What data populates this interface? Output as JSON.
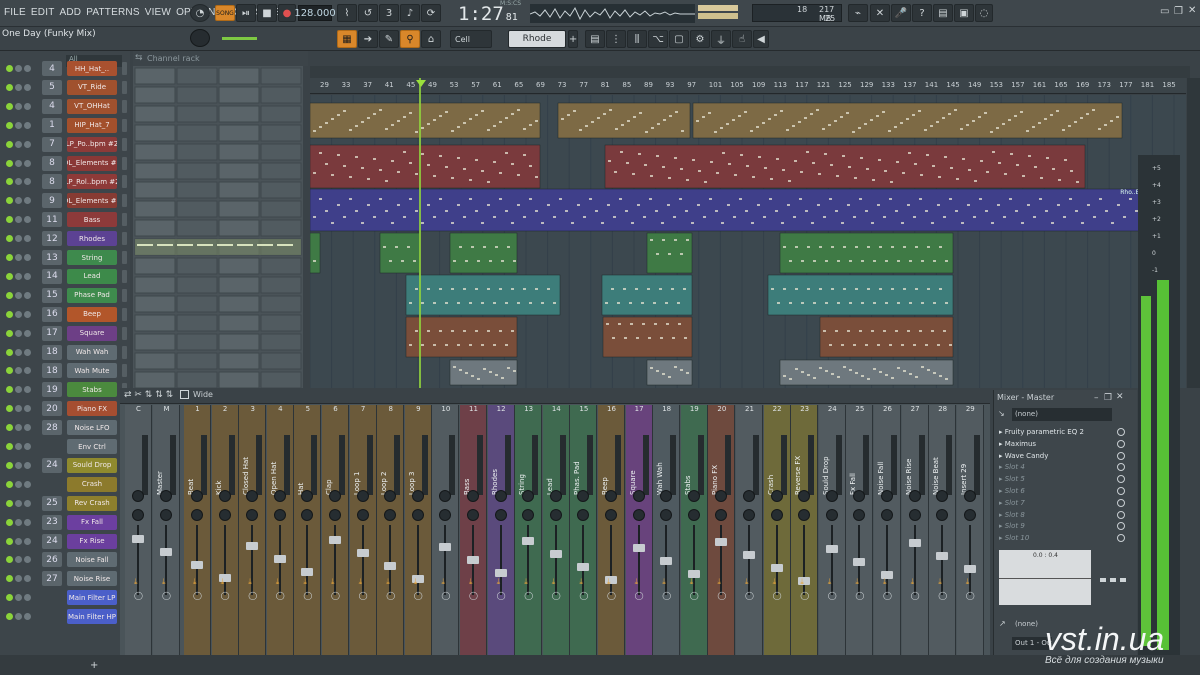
{
  "menu": [
    "FILE",
    "EDIT",
    "ADD",
    "PATTERNS",
    "VIEW",
    "OPTIONS",
    "TOOLS",
    "HELP"
  ],
  "transport": {
    "mode": "SONG",
    "tempo": "128.000",
    "position": "1:27",
    "position_ticks": "81",
    "position_unit": "M:S:CS"
  },
  "cpu": {
    "voices": "18",
    "memory": "217 MB",
    "polyphony": "25"
  },
  "song_title": "One Day (Funky Mix)",
  "hint_toolbar": {
    "snap": "Cell",
    "pattern": "Rhode"
  },
  "channel_rack": {
    "title": "Channel rack",
    "filter": "All",
    "channels": [
      {
        "num": "4",
        "name": "HH_Hat_..",
        "color": "#a9512f"
      },
      {
        "num": "5",
        "name": "VT_Ride",
        "color": "#a0512e"
      },
      {
        "num": "4",
        "name": "VT_OHHat",
        "color": "#a0512e"
      },
      {
        "num": "1",
        "name": "HIP_Hat_7",
        "color": "#a3502c"
      },
      {
        "num": "7",
        "name": "LP_Po..bpm #2",
        "color": "#8d3a38"
      },
      {
        "num": "8",
        "name": "DL_Elements #2",
        "color": "#8a3836"
      },
      {
        "num": "8",
        "name": "LP_Rol..bpm #2",
        "color": "#8e3a38"
      },
      {
        "num": "9",
        "name": "DL_Elements #3",
        "color": "#873b33"
      },
      {
        "num": "11",
        "name": "Bass",
        "color": "#8d3a3a"
      },
      {
        "num": "12",
        "name": "Rhodes",
        "color": "#5c4293"
      },
      {
        "num": "13",
        "name": "String",
        "color": "#3e8a4d"
      },
      {
        "num": "14",
        "name": "Lead",
        "color": "#3d8a4a"
      },
      {
        "num": "15",
        "name": "Phase Pad",
        "color": "#3e8b4d"
      },
      {
        "num": "16",
        "name": "Beep",
        "color": "#b2562a"
      },
      {
        "num": "17",
        "name": "Square",
        "color": "#6d3f86"
      },
      {
        "num": "18",
        "name": "Wah Wah",
        "color": "#5f6b72"
      },
      {
        "num": "18",
        "name": "Wah Mute",
        "color": "#5f6b72"
      },
      {
        "num": "19",
        "name": "Stabs",
        "color": "#4b8a3e"
      },
      {
        "num": "20",
        "name": "Piano FX",
        "color": "#a54e31"
      },
      {
        "num": "28",
        "name": "Noise LFO",
        "color": "#5f6b72"
      },
      {
        "num": "",
        "name": "Env Ctrl",
        "color": "#5f6b72"
      },
      {
        "num": "24",
        "name": "Sould Drop",
        "color": "#8f8a2e"
      },
      {
        "num": "",
        "name": "Crash",
        "color": "#8c7a2c"
      },
      {
        "num": "25",
        "name": "Rev Crash",
        "color": "#8d7f2d"
      },
      {
        "num": "23",
        "name": "Fx Fall",
        "color": "#6c3fa0"
      },
      {
        "num": "24",
        "name": "Fx Rise",
        "color": "#6b3f9e"
      },
      {
        "num": "26",
        "name": "Noise Fall",
        "color": "#5f6b72"
      },
      {
        "num": "27",
        "name": "Noise Rise",
        "color": "#5f6b72"
      },
      {
        "num": "",
        "name": "Main Filter LP",
        "color": "#4b5fc9"
      },
      {
        "num": "",
        "name": "Main Filter HP",
        "color": "#4b5fc9"
      }
    ]
  },
  "playlist": {
    "bars": [
      "29",
      "33",
      "37",
      "41",
      "45",
      "49",
      "53",
      "57",
      "61",
      "65",
      "69",
      "73",
      "77",
      "81",
      "85",
      "89",
      "93",
      "97",
      "101",
      "105",
      "109",
      "113",
      "117",
      "121",
      "125",
      "129",
      "133",
      "137",
      "141",
      "145",
      "149",
      "153",
      "157",
      "161",
      "165",
      "169",
      "173",
      "177",
      "181",
      "185"
    ],
    "tail_label": "Rho..Entr"
  },
  "mixer": {
    "title": "Wide",
    "panel_title": "Mixer - Master",
    "input": "(none)",
    "output": "(none)",
    "out_route": "Out 1 - Out",
    "eq_label": "0.0 : 0.4",
    "strips": [
      {
        "num": "C",
        "name": "",
        "color": "#525b60"
      },
      {
        "num": "M",
        "name": "Master",
        "color": "#525b60"
      },
      {
        "num": "1",
        "name": "Beat",
        "color": "#6b5a3a"
      },
      {
        "num": "2",
        "name": "Kick",
        "color": "#6b5a3a"
      },
      {
        "num": "3",
        "name": "Closed Hat",
        "color": "#6b5a3a"
      },
      {
        "num": "4",
        "name": "Open Hat",
        "color": "#6b5a3a"
      },
      {
        "num": "5",
        "name": "Hat",
        "color": "#6b5a3a"
      },
      {
        "num": "6",
        "name": "Clap",
        "color": "#6b5a3a"
      },
      {
        "num": "7",
        "name": "Loop 1",
        "color": "#6b5a3a"
      },
      {
        "num": "8",
        "name": "Loop 2",
        "color": "#6b5a3a"
      },
      {
        "num": "9",
        "name": "Loop 3",
        "color": "#6b5a3a"
      },
      {
        "num": "10",
        "name": "",
        "color": "#525b60"
      },
      {
        "num": "11",
        "name": "Bass",
        "color": "#6e4048"
      },
      {
        "num": "12",
        "name": "Rhodes",
        "color": "#5a4a7c"
      },
      {
        "num": "13",
        "name": "String",
        "color": "#3f6a50"
      },
      {
        "num": "14",
        "name": "Lead",
        "color": "#3f6a50"
      },
      {
        "num": "15",
        "name": "Phas. Pad",
        "color": "#3f6a50"
      },
      {
        "num": "16",
        "name": "Beep",
        "color": "#6b5a3a"
      },
      {
        "num": "17",
        "name": "Square",
        "color": "#68437c"
      },
      {
        "num": "18",
        "name": "Wah Wah",
        "color": "#4f5a60"
      },
      {
        "num": "19",
        "name": "Stabs",
        "color": "#3f6a50"
      },
      {
        "num": "20",
        "name": "Piano FX",
        "color": "#6e4a3e"
      },
      {
        "num": "21",
        "name": "",
        "color": "#525b60"
      },
      {
        "num": "22",
        "name": "Crash",
        "color": "#6e6a3a"
      },
      {
        "num": "23",
        "name": "Reverse FX",
        "color": "#6e6a3a"
      },
      {
        "num": "24",
        "name": "Sould Drop",
        "color": "#525b60"
      },
      {
        "num": "25",
        "name": "Fx Fall",
        "color": "#525b60"
      },
      {
        "num": "26",
        "name": "Noise Fall",
        "color": "#525b60"
      },
      {
        "num": "27",
        "name": "Noise Rise",
        "color": "#525b60"
      },
      {
        "num": "28",
        "name": "Noise Beat",
        "color": "#525b60"
      },
      {
        "num": "29",
        "name": "Insert 29",
        "color": "#525b60"
      }
    ],
    "slots": [
      "Fruity parametric EQ 2",
      "Maximus",
      "Wave Candy",
      "Slot 4",
      "Slot 5",
      "Slot 6",
      "Slot 7",
      "Slot 8",
      "Slot 9",
      "Slot 10"
    ]
  },
  "meter_labels": [
    "+5",
    "+4",
    "+3",
    "+2",
    "+1",
    "0",
    "-1"
  ],
  "watermark": "vst.in.ua",
  "watermark_sub": "Всё для создания музыки"
}
